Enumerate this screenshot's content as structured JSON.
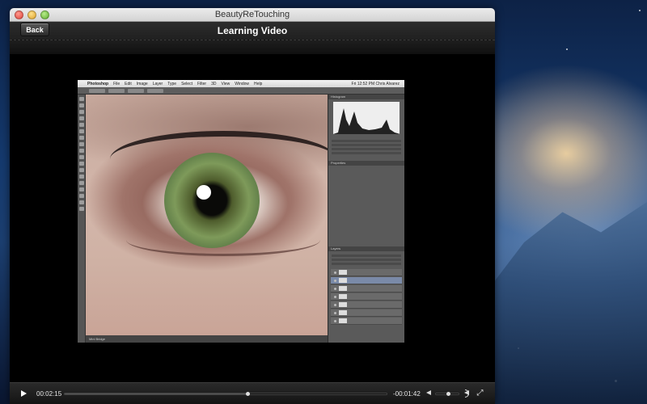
{
  "window": {
    "title": "BeautyReTouching"
  },
  "toolbar": {
    "back_label": "Back",
    "title": "Learning Video"
  },
  "photoshop": {
    "app_name": "Photoshop",
    "menu": [
      "File",
      "Edit",
      "Image",
      "Layer",
      "Type",
      "Select",
      "Filter",
      "3D",
      "View",
      "Window",
      "Help"
    ],
    "clock": "Fri 12:52 PM",
    "user": "Chris Alvarez",
    "panel_histogram": "Histogram",
    "panel_properties": "Properties",
    "panel_layers": "Layers",
    "status_tab": "Mini Bridge"
  },
  "player": {
    "elapsed": "00:02:15",
    "remaining": "-00:01:42",
    "progress": 0.57,
    "volume": 0.55
  }
}
